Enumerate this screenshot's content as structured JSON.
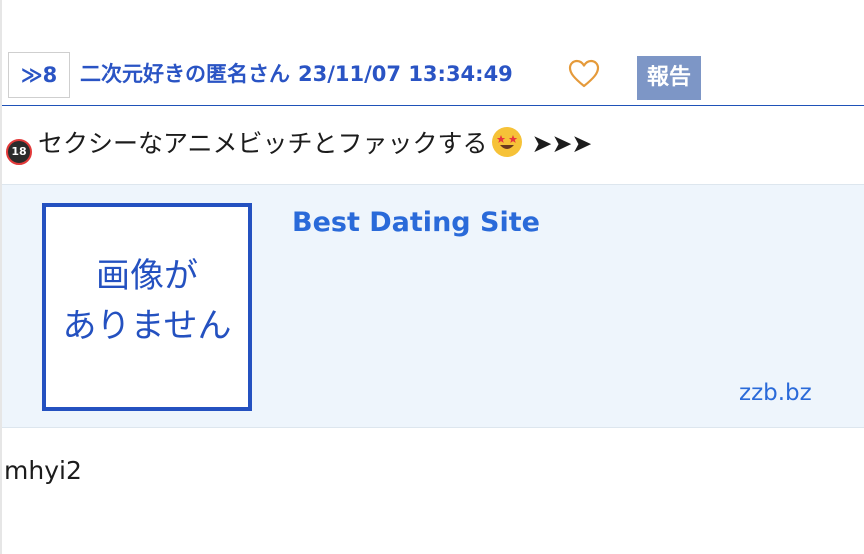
{
  "post": {
    "number_label": "≫8",
    "author": "二次元好きの匿名さん",
    "datetime": "23/11/07 13:34:49",
    "report_label": "報告",
    "body": {
      "badge": "18",
      "text": "セクシーなアニメビッチとファックする",
      "arrows": "➤➤➤"
    },
    "link_card": {
      "thumbnail_line1": "画像が",
      "thumbnail_line2": "ありません",
      "title": "Best Dating Site",
      "domain": "zzb.bz"
    },
    "footer": "mhyi2"
  },
  "icons": {
    "like": "heart-outline-icon",
    "adult": "no-under-18-icon",
    "emoji": "star-struck-emoji-icon"
  },
  "colors": {
    "accent": "#2a54c4",
    "link": "#2a6ad9",
    "report_bg": "#7d96c6",
    "card_bg": "#eef5fc",
    "heart": "#e59a3a"
  }
}
